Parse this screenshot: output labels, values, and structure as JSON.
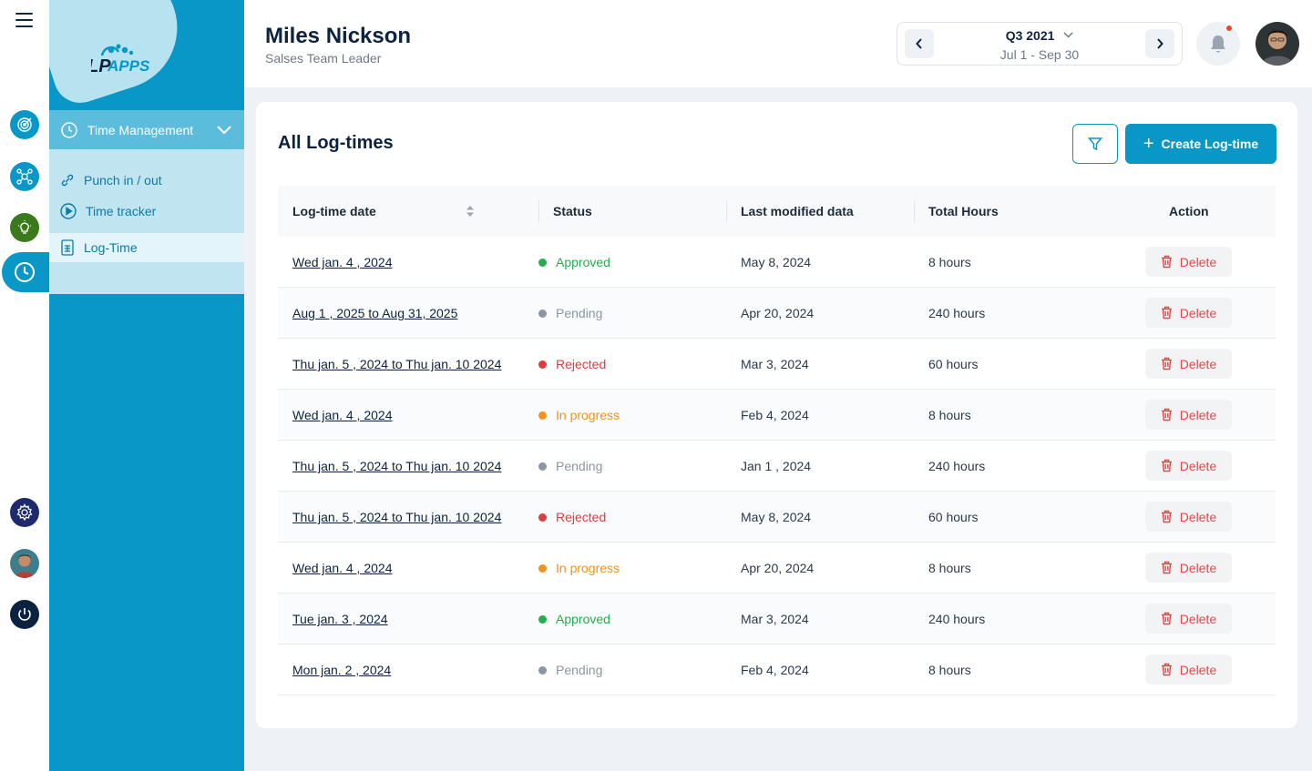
{
  "app": {
    "logo_text": "APPS",
    "logo_mark": "LP"
  },
  "sidebar": {
    "section": {
      "label": "Time Management"
    },
    "items": [
      {
        "label": "Punch in / out",
        "icon": "link-icon"
      },
      {
        "label": "Time tracker",
        "icon": "play-icon"
      },
      {
        "label": "Log-Time",
        "icon": "sheet-icon",
        "active": true
      }
    ]
  },
  "header": {
    "user_name": "Miles Nickson",
    "user_role": "Salses Team Leader",
    "period": {
      "title": "Q3 2021",
      "range": "Jul 1 - Sep 30"
    }
  },
  "card": {
    "title": "All Log-times",
    "create_label": "Create Log-time"
  },
  "table": {
    "headers": {
      "date": "Log-time date",
      "status": "Status",
      "modified": "Last modified data",
      "hours": "Total Hours",
      "action": "Action"
    },
    "delete_label": "Delete",
    "rows": [
      {
        "date": "Wed jan. 4 , 2024",
        "status": "Approved",
        "status_color": "#22b04b",
        "modified": "May 8, 2024",
        "hours": "8 hours"
      },
      {
        "date": "Aug 1 , 2025 to Aug 31, 2025",
        "status": "Pending",
        "status_color": "#8a96a3",
        "modified": "Apr 20, 2024",
        "hours": "240 hours"
      },
      {
        "date": "Thu jan. 5 , 2024 to Thu jan. 10 2024",
        "status": "Rejected",
        "status_color": "#e03c3c",
        "modified": "Mar 3, 2024",
        "hours": "60 hours"
      },
      {
        "date": "Wed jan. 4 , 2024",
        "status": "In progress",
        "status_color": "#f5921e",
        "modified": "Feb 4, 2024",
        "hours": "8 hours"
      },
      {
        "date": "Thu jan. 5 , 2024 to Thu jan. 10 2024",
        "status": "Pending",
        "status_color": "#8a96a3",
        "modified": "Jan 1 , 2024",
        "hours": "240 hours"
      },
      {
        "date": "Thu jan. 5 , 2024 to Thu jan. 10 2024",
        "status": "Rejected",
        "status_color": "#e03c3c",
        "modified": "May 8, 2024",
        "hours": "60 hours"
      },
      {
        "date": "Wed jan. 4 , 2024",
        "status": "In progress",
        "status_color": "#f5921e",
        "modified": "Apr 20, 2024",
        "hours": "8 hours"
      },
      {
        "date": "Tue jan. 3 , 2024",
        "status": "Approved",
        "status_color": "#22b04b",
        "modified": "Mar 3, 2024",
        "hours": "240 hours"
      },
      {
        "date": "Mon jan. 2 , 2024",
        "status": "Pending",
        "status_color": "#8a96a3",
        "modified": "Feb 4, 2024",
        "hours": "8 hours"
      }
    ]
  }
}
